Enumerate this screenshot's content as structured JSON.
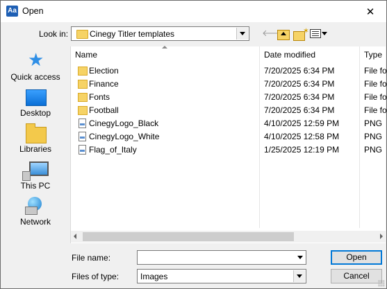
{
  "titlebar": {
    "app_icon": "Aa",
    "title": "Open",
    "close_icon": "close-icon"
  },
  "lookin": {
    "label": "Look in:",
    "value": "Cinegy Titler templates"
  },
  "toolbar": {
    "back_icon": "back-arrow-icon",
    "up_icon": "up-folder-icon",
    "new_folder_icon": "new-folder-icon",
    "view_icon": "view-menu-icon"
  },
  "places": [
    {
      "label": "Quick access",
      "icon": "star-icon"
    },
    {
      "label": "Desktop",
      "icon": "desktop-icon"
    },
    {
      "label": "Libraries",
      "icon": "libraries-icon"
    },
    {
      "label": "This PC",
      "icon": "computer-icon"
    },
    {
      "label": "Network",
      "icon": "network-icon"
    }
  ],
  "list": {
    "columns": {
      "name": "Name",
      "date": "Date modified",
      "type": "Type"
    },
    "rows": [
      {
        "name": "Election",
        "date": "7/20/2025 6:34 PM",
        "type": "File folder",
        "kind": "folder"
      },
      {
        "name": "Finance",
        "date": "7/20/2025 6:34 PM",
        "type": "File folder",
        "kind": "folder"
      },
      {
        "name": "Fonts",
        "date": "7/20/2025 6:34 PM",
        "type": "File folder",
        "kind": "folder"
      },
      {
        "name": "Football",
        "date": "7/20/2025 6:34 PM",
        "type": "File folder",
        "kind": "folder"
      },
      {
        "name": "CinegyLogo_Black",
        "date": "4/10/2025 12:59 PM",
        "type": "PNG",
        "kind": "file"
      },
      {
        "name": "CinegyLogo_White",
        "date": "4/10/2025 12:58 PM",
        "type": "PNG",
        "kind": "file"
      },
      {
        "name": "Flag_of_Italy",
        "date": "1/25/2025 12:19 PM",
        "type": "PNG",
        "kind": "file"
      }
    ]
  },
  "filename": {
    "label": "File name:",
    "value": ""
  },
  "filetype": {
    "label": "Files of type:",
    "value": "Images"
  },
  "buttons": {
    "open": "Open",
    "cancel": "Cancel"
  }
}
